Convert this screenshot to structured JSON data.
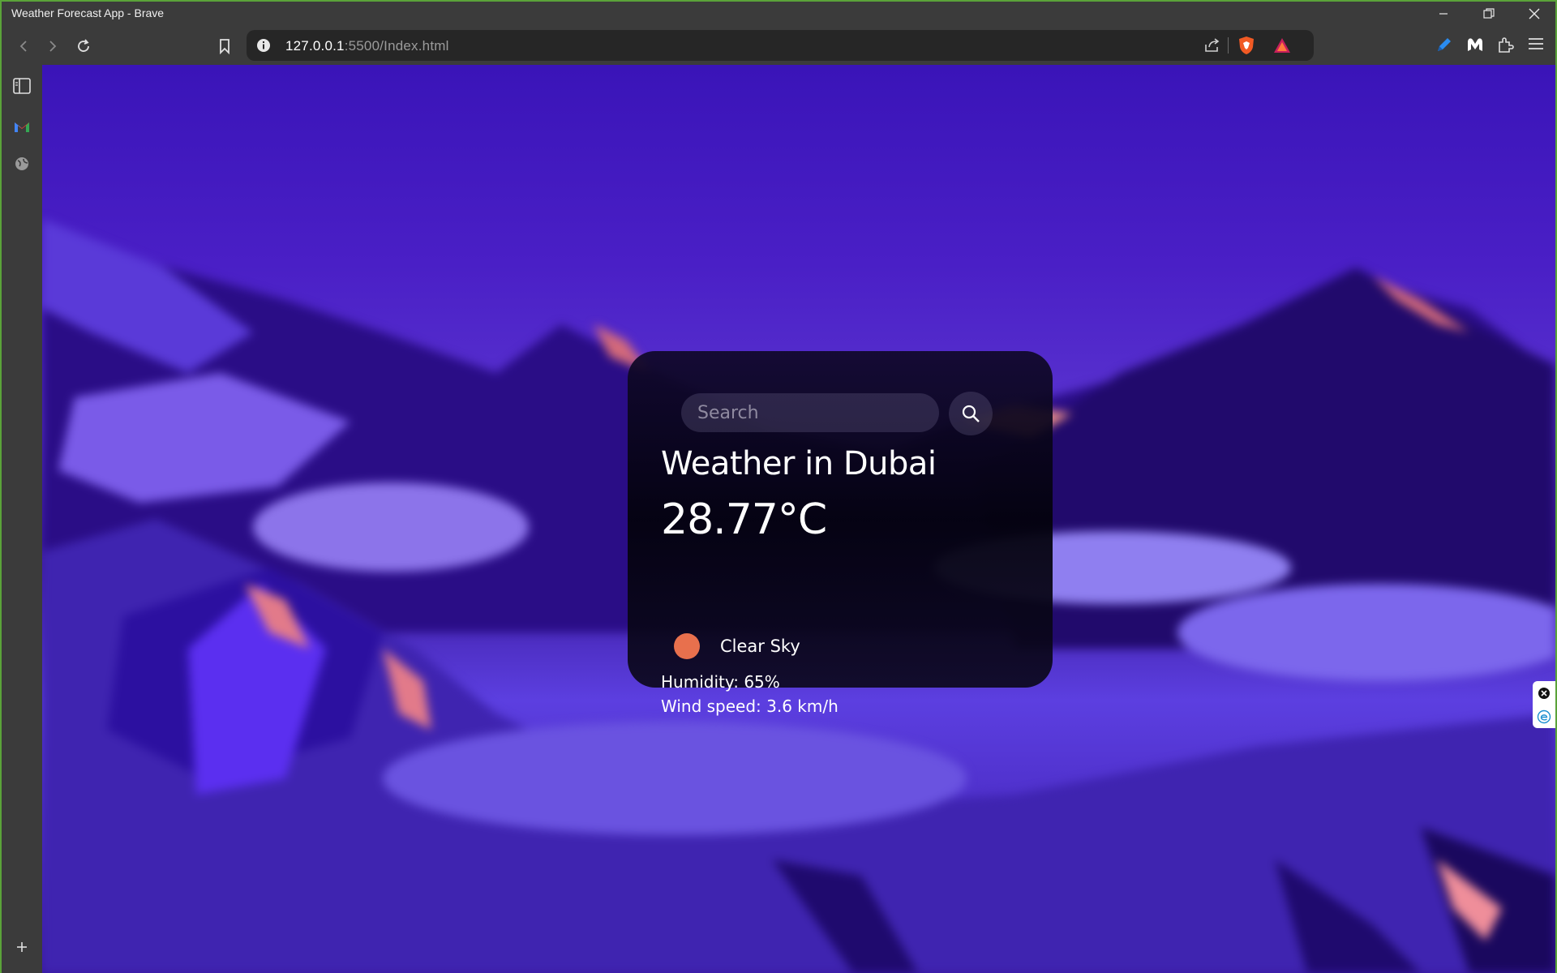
{
  "window": {
    "title": "Weather Forecast App - Brave",
    "minimize_icon": "minimize-icon",
    "restore_icon": "restore-icon",
    "close_icon": "close-icon"
  },
  "toolbar": {
    "url_host": "127.0.0.1",
    "url_path": ":5500/Index.html",
    "icons": [
      "back-icon",
      "forward-icon",
      "reload-icon",
      "bookmark-icon",
      "site-info-icon",
      "share-icon",
      "brave-shields-icon",
      "brave-rewards-icon",
      "pen-extension-icon",
      "malwarebytes-icon",
      "extensions-icon",
      "menu-icon"
    ]
  },
  "sidebar": {
    "icons": [
      "sidebar-toggle-icon",
      "gmail-icon",
      "globe-icon",
      "add-icon"
    ]
  },
  "weather": {
    "search_placeholder": "Search",
    "title": "Weather in Dubai",
    "temperature": "28.77°C",
    "description": "Clear Sky",
    "humidity": "Humidity: 65%",
    "wind": "Wind speed: 3.6 km/h"
  },
  "colors": {
    "window_border": "#5aa339",
    "chrome": "#3b3b3b",
    "card": "#0b0720",
    "accent_sun": "#e8704d",
    "sky": "#4a1fc6"
  }
}
